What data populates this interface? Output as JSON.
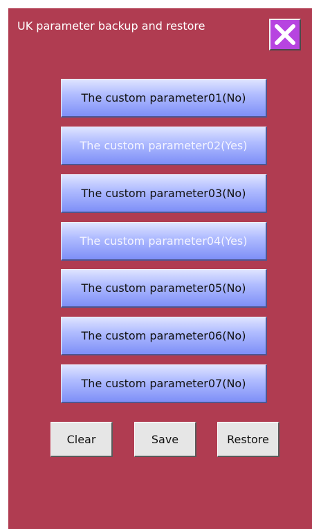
{
  "window": {
    "title": "UK parameter backup and restore",
    "close_icon": "close-x-icon",
    "background_color": "#b03c51",
    "close_button_color": "#b744e0"
  },
  "parameters": [
    {
      "label": "The custom parameter01(No)",
      "saved": false
    },
    {
      "label": "The custom parameter02(Yes)",
      "saved": true
    },
    {
      "label": "The custom parameter03(No)",
      "saved": false
    },
    {
      "label": "The custom parameter04(Yes)",
      "saved": true
    },
    {
      "label": "The custom parameter05(No)",
      "saved": false
    },
    {
      "label": "The custom parameter06(No)",
      "saved": false
    },
    {
      "label": "The custom parameter07(No)",
      "saved": false
    }
  ],
  "actions": {
    "clear_label": "Clear",
    "save_label": "Save",
    "restore_label": "Restore"
  }
}
